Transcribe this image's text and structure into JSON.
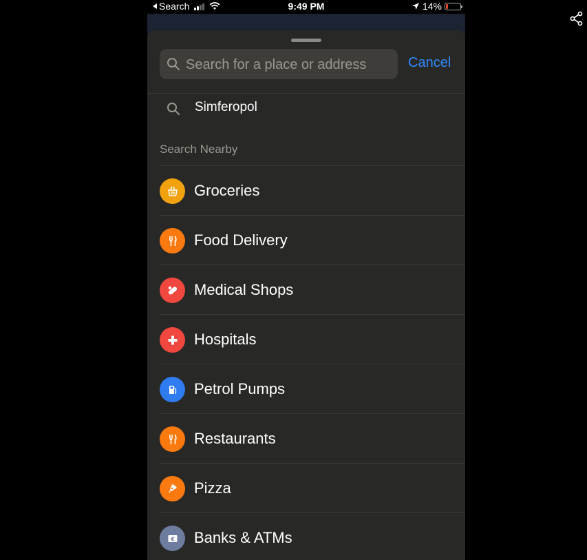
{
  "status_bar": {
    "back_label": "Search",
    "time": "9:49 PM",
    "battery_percent": "14%",
    "battery_level": 0.14,
    "icons": [
      "back-arrow-icon",
      "cellular-signal-icon",
      "wifi-icon",
      "location-arrow-icon",
      "battery-icon"
    ]
  },
  "search": {
    "placeholder": "Search for a place or address",
    "value": "",
    "cancel_label": "Cancel"
  },
  "recent": {
    "label": "Simferopol",
    "icon": "search-icon"
  },
  "nearby": {
    "header": "Search Nearby",
    "items": [
      {
        "label": "Groceries",
        "icon": "basket-icon",
        "color": "#f2a20f"
      },
      {
        "label": "Food Delivery",
        "icon": "fork-knife-icon",
        "color": "#fb7a0f"
      },
      {
        "label": "Medical Shops",
        "icon": "pill-icon",
        "color": "#f0473f"
      },
      {
        "label": "Hospitals",
        "icon": "cross-icon",
        "color": "#f0473f"
      },
      {
        "label": "Petrol Pumps",
        "icon": "fuel-pump-icon",
        "color": "#2f7bf0"
      },
      {
        "label": "Restaurants",
        "icon": "fork-knife-icon",
        "color": "#fb7a0f"
      },
      {
        "label": "Pizza",
        "icon": "pizza-icon",
        "color": "#fb7a0f"
      },
      {
        "label": "Banks & ATMs",
        "icon": "bank-icon",
        "color": "#6e7ca0"
      }
    ]
  },
  "colors": {
    "accent": "#2f8bff",
    "sheet_background": "#282826",
    "search_field": "#3e3d39"
  },
  "share": {
    "icon": "share-icon"
  }
}
